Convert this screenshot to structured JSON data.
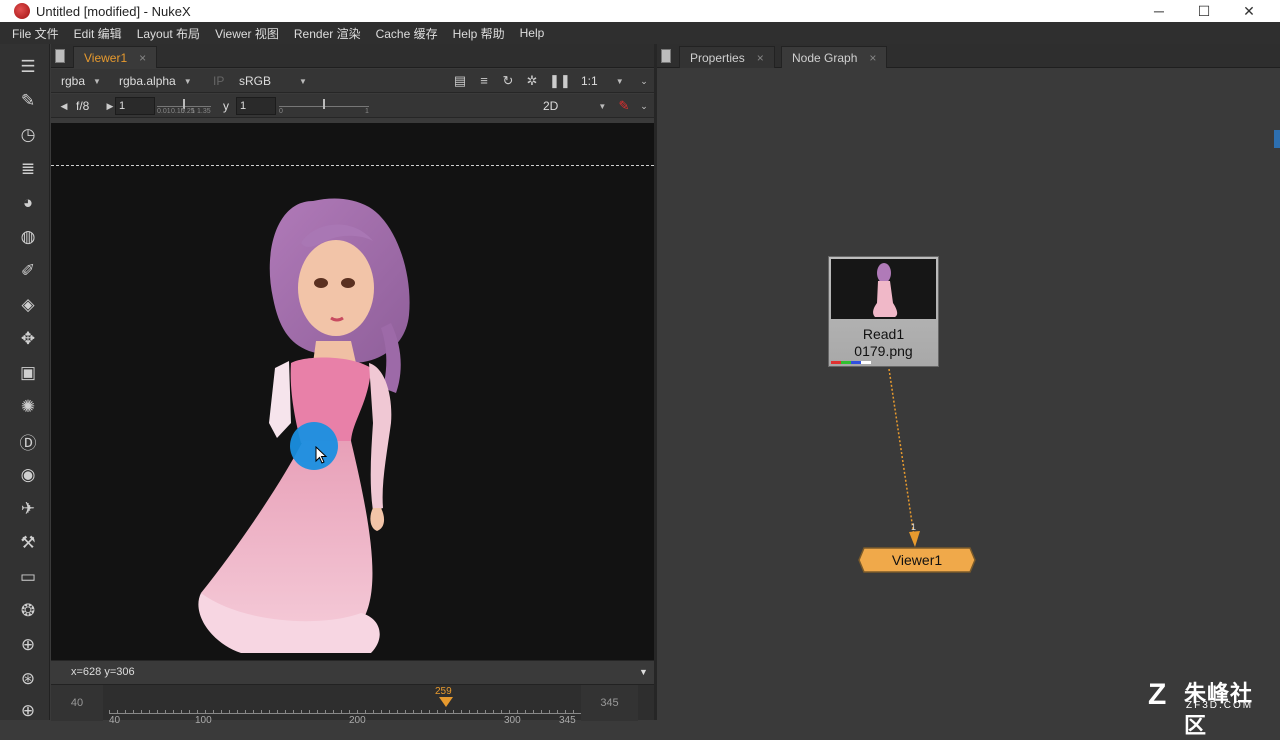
{
  "window": {
    "title": "Untitled [modified] - NukeX",
    "minimize": "─",
    "maximize": "☐",
    "close": "✕"
  },
  "menu": [
    "File 文件",
    "Edit 编辑",
    "Layout 布局",
    "Viewer 视图",
    "Render 渲染",
    "Cache 缓存",
    "Help 帮助",
    "Help"
  ],
  "toolbar_icons": [
    "image-icon",
    "draw-icon",
    "time-icon",
    "channel-icon",
    "color-icon",
    "filter-icon",
    "keyer-icon",
    "merge-icon",
    "transform-icon",
    "3d-icon",
    "particles-icon",
    "deep-icon",
    "views-icon",
    "metadata-icon",
    "toolsets-icon",
    "other-icon",
    "furnace-icon",
    "ocula-icon",
    "cara-icon",
    "python-icon"
  ],
  "viewer_panel": {
    "tab_label": "Viewer1",
    "tab_close": "×",
    "channels": "rgba",
    "alpha_channel": "rgba.alpha",
    "ip_label": "IP",
    "lut": "sRGB",
    "zoom": "1:1",
    "fstop": "f/8",
    "gain_value": "1",
    "gain_ticks": [
      "0.01",
      "0.15",
      "0.25",
      "1",
      "1.35"
    ],
    "gamma_label": "y",
    "gamma_value": "1",
    "gamma_ticks": [
      "0",
      "1"
    ],
    "view_mode": "2D",
    "coords": "x=628 y=306",
    "timeline": {
      "in_frame": "40",
      "out_frame": "345",
      "current_frame": "259",
      "ruler_labels": [
        "40",
        "100",
        "200",
        "300",
        "345"
      ]
    }
  },
  "node_panel": {
    "tabs": [
      {
        "label": "Properties",
        "close": "×"
      },
      {
        "label": "Node Graph",
        "close": "×"
      }
    ],
    "read_node": {
      "name": "Read1",
      "file": "0179.png"
    },
    "viewer_node": {
      "name": "Viewer1",
      "input_label": "1"
    }
  },
  "watermark": {
    "cn": "朱峰社区",
    "en": "ZF3D.COM"
  },
  "colors": {
    "accent": "#e79a2e",
    "viewer_node": "#f0a94a",
    "cursor_ring": "#1a8fe0"
  }
}
